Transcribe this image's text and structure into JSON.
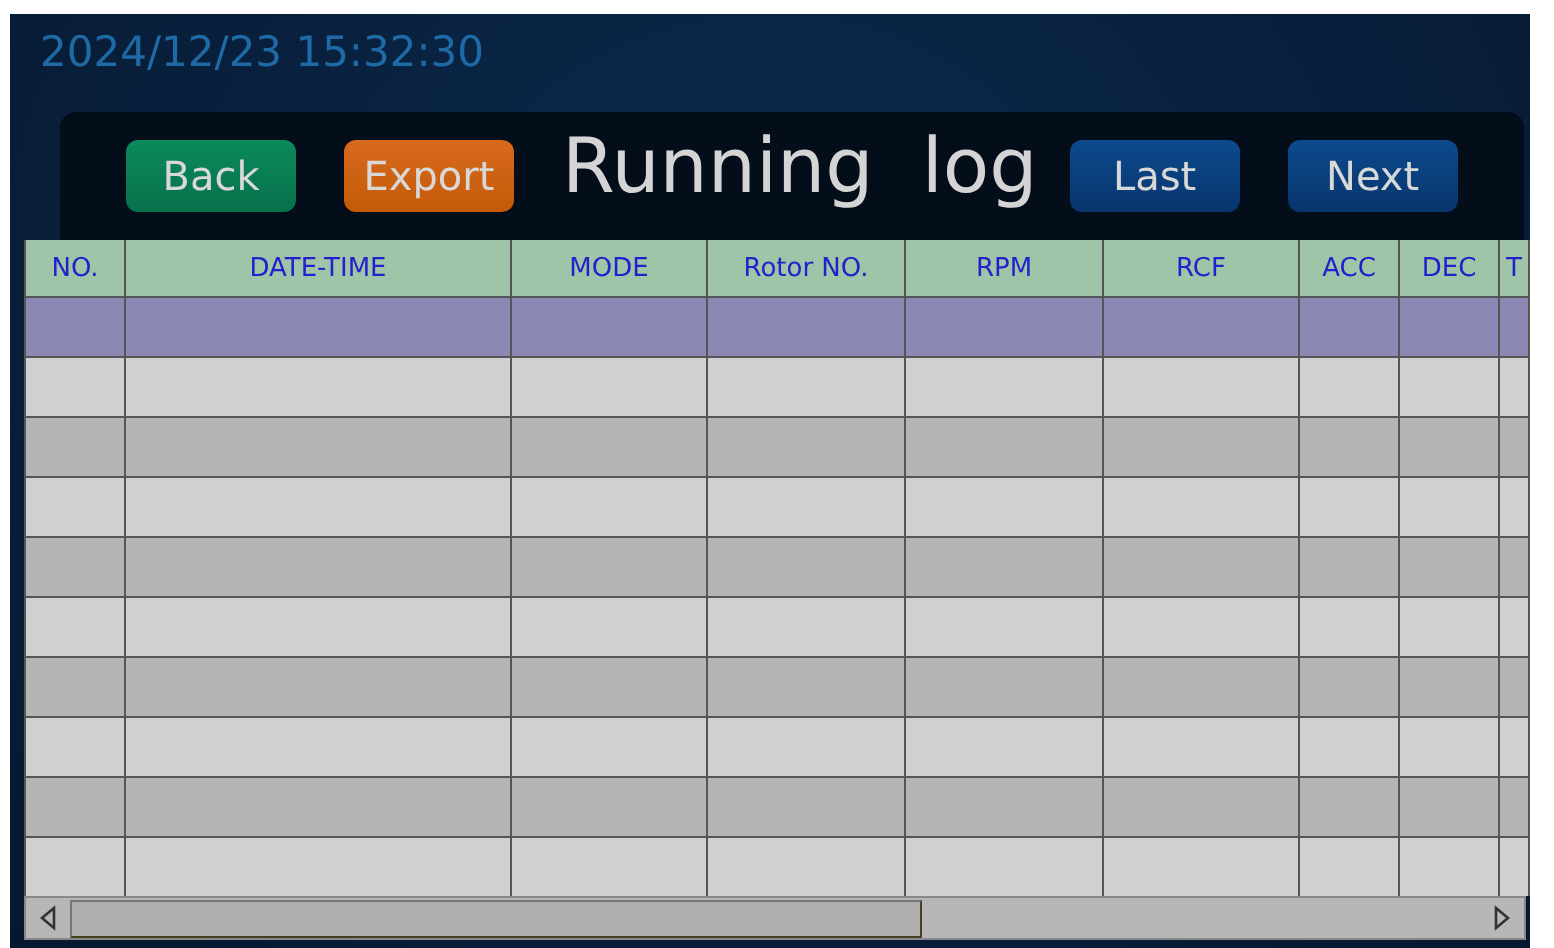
{
  "datetime": "2024/12/23 15:32:30",
  "toolbar": {
    "buttons": [
      {
        "label": "Back",
        "kind": "back"
      },
      {
        "label": "Export",
        "kind": "export"
      }
    ],
    "title": "Running  log",
    "nav_buttons": [
      {
        "label": "Last"
      },
      {
        "label": "Next"
      }
    ]
  },
  "table": {
    "columns": [
      "NO.",
      "DATE-TIME",
      "MODE",
      "Rotor NO.",
      "RPM",
      "RCF",
      "ACC",
      "DEC",
      "T"
    ],
    "rows": [
      {
        "selected": true
      },
      {
        "selected": false
      },
      {
        "selected": false
      },
      {
        "selected": false
      },
      {
        "selected": false
      },
      {
        "selected": false
      },
      {
        "selected": false
      },
      {
        "selected": false
      },
      {
        "selected": false
      },
      {
        "selected": false
      }
    ]
  }
}
